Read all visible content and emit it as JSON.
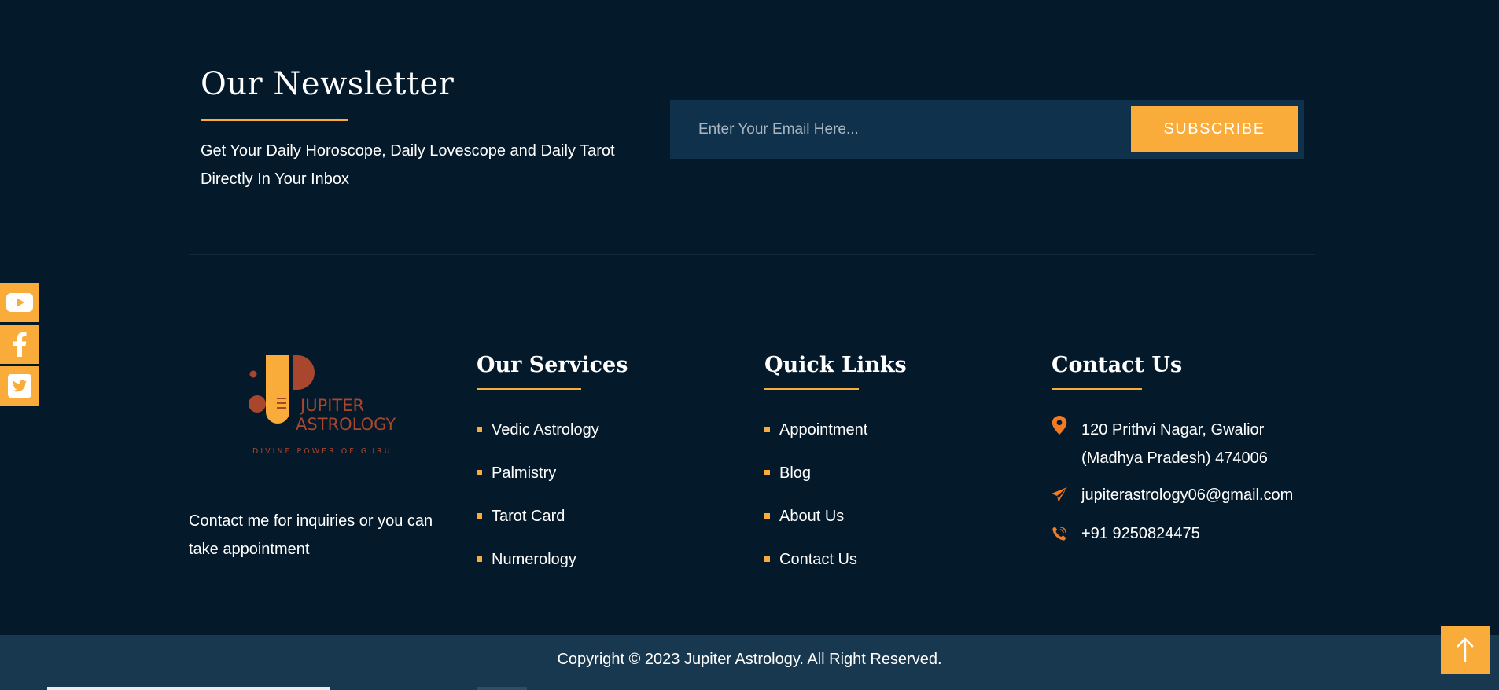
{
  "newsletter": {
    "title": "Our Newsletter",
    "description": "Get Your Daily Horoscope, Daily Lovescope and Daily Tarot Directly In Your Inbox",
    "email_placeholder": "Enter Your Email Here...",
    "subscribe_label": "SUBSCRIBE"
  },
  "social": {
    "items": [
      {
        "icon": "youtube-icon"
      },
      {
        "icon": "facebook-icon"
      },
      {
        "icon": "twitter-icon"
      }
    ]
  },
  "brand": {
    "logo_line1": "JUPITER",
    "logo_line2": "ASTROLOGY",
    "tagline": "DIVINE POWER OF GURU",
    "about_text": "Contact me for inquiries or you can take appointment"
  },
  "services": {
    "title": "Our Services",
    "items": [
      "Vedic Astrology",
      "Palmistry",
      "Tarot Card",
      "Numerology"
    ]
  },
  "quick_links": {
    "title": "Quick Links",
    "items": [
      "Appointment",
      "Blog",
      "About Us",
      "Contact Us"
    ]
  },
  "contact": {
    "title": "Contact Us",
    "address": "120 Prithvi Nagar, Gwalior (Madhya Pradesh) 474006",
    "email": "jupiterastrology06@gmail.com",
    "phone": "+91 9250824475"
  },
  "footer": {
    "copyright": "Copyright © 2023 Jupiter Astrology. All Right Reserved."
  },
  "colors": {
    "background": "#04192a",
    "accent": "#f9ac3a",
    "logo_brown": "#a8472e",
    "contact_icon": "#f27a21",
    "bottom_bar": "#183850",
    "form_bg": "#10314b"
  }
}
